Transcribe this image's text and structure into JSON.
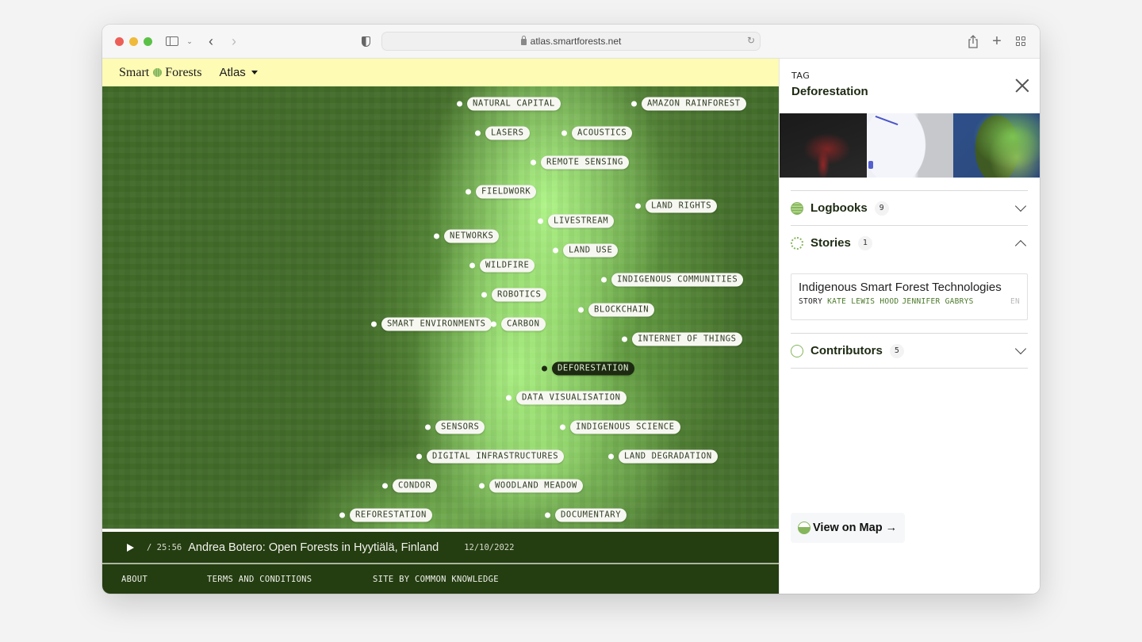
{
  "browser": {
    "url": "atlas.smartforests.net",
    "icons": [
      "sidebar-icon",
      "chevron-down-icon",
      "back-icon",
      "forward-icon",
      "privacy-shield-icon",
      "lock-icon",
      "reload-icon",
      "share-icon",
      "new-tab-icon",
      "tab-overview-icon"
    ]
  },
  "nav": {
    "brand_left": "Smart",
    "brand_right": "Forests",
    "menu_label": "Atlas"
  },
  "map": {
    "tags": [
      {
        "label": "NATURAL CAPITAL",
        "active": false
      },
      {
        "label": "AMAZON RAINFOREST",
        "active": false
      },
      {
        "label": "LASERS",
        "active": false
      },
      {
        "label": "ACOUSTICS",
        "active": false
      },
      {
        "label": "REMOTE SENSING",
        "active": false
      },
      {
        "label": "FIELDWORK",
        "active": false
      },
      {
        "label": "LAND RIGHTS",
        "active": false
      },
      {
        "label": "LIVESTREAM",
        "active": false
      },
      {
        "label": "NETWORKS",
        "active": false
      },
      {
        "label": "LAND USE",
        "active": false
      },
      {
        "label": "WILDFIRE",
        "active": false
      },
      {
        "label": "INDIGENOUS COMMUNITIES",
        "active": false
      },
      {
        "label": "ROBOTICS",
        "active": false
      },
      {
        "label": "BLOCKCHAIN",
        "active": false
      },
      {
        "label": "SMART ENVIRONMENTS",
        "active": false
      },
      {
        "label": "CARBON",
        "active": false
      },
      {
        "label": "INTERNET OF THINGS",
        "active": false
      },
      {
        "label": "DEFORESTATION",
        "active": true
      },
      {
        "label": "DATA VISUALISATION",
        "active": false
      },
      {
        "label": "SENSORS",
        "active": false
      },
      {
        "label": "INDIGENOUS SCIENCE",
        "active": false
      },
      {
        "label": "DIGITAL INFRASTRUCTURES",
        "active": false
      },
      {
        "label": "LAND DEGRADATION",
        "active": false
      },
      {
        "label": "CONDOR",
        "active": false
      },
      {
        "label": "WOODLAND MEADOW",
        "active": false
      },
      {
        "label": "REFORESTATION",
        "active": false
      },
      {
        "label": "DOCUMENTARY",
        "active": false
      }
    ]
  },
  "player": {
    "duration": "/ 25:56",
    "title": "Andrea Botero: Open Forests in Hyytiälä, Finland",
    "date": "12/10/2022"
  },
  "footer": {
    "about": "ABOUT",
    "terms": "TERMS AND CONDITIONS",
    "credit": "SITE BY COMMON KNOWLEDGE"
  },
  "panel": {
    "kicker": "TAG",
    "title": "Deforestation",
    "images": [
      "dark-deforestation-map-image",
      "brazil-water-map-image",
      "south-america-satellite-image"
    ],
    "sections": {
      "logbooks": {
        "label": "Logbooks",
        "count": "9",
        "expanded": false
      },
      "stories": {
        "label": "Stories",
        "count": "1",
        "expanded": true
      },
      "contributors": {
        "label": "Contributors",
        "count": "5",
        "expanded": false
      }
    },
    "story": {
      "title": "Indigenous Smart Forest Technologies",
      "type": "STORY",
      "authors": [
        "KATE LEWIS HOOD",
        "JENNIFER GABRYS"
      ],
      "lang": "EN"
    },
    "view_map_label": "View on Map →",
    "accent_color": "#86b65c"
  }
}
